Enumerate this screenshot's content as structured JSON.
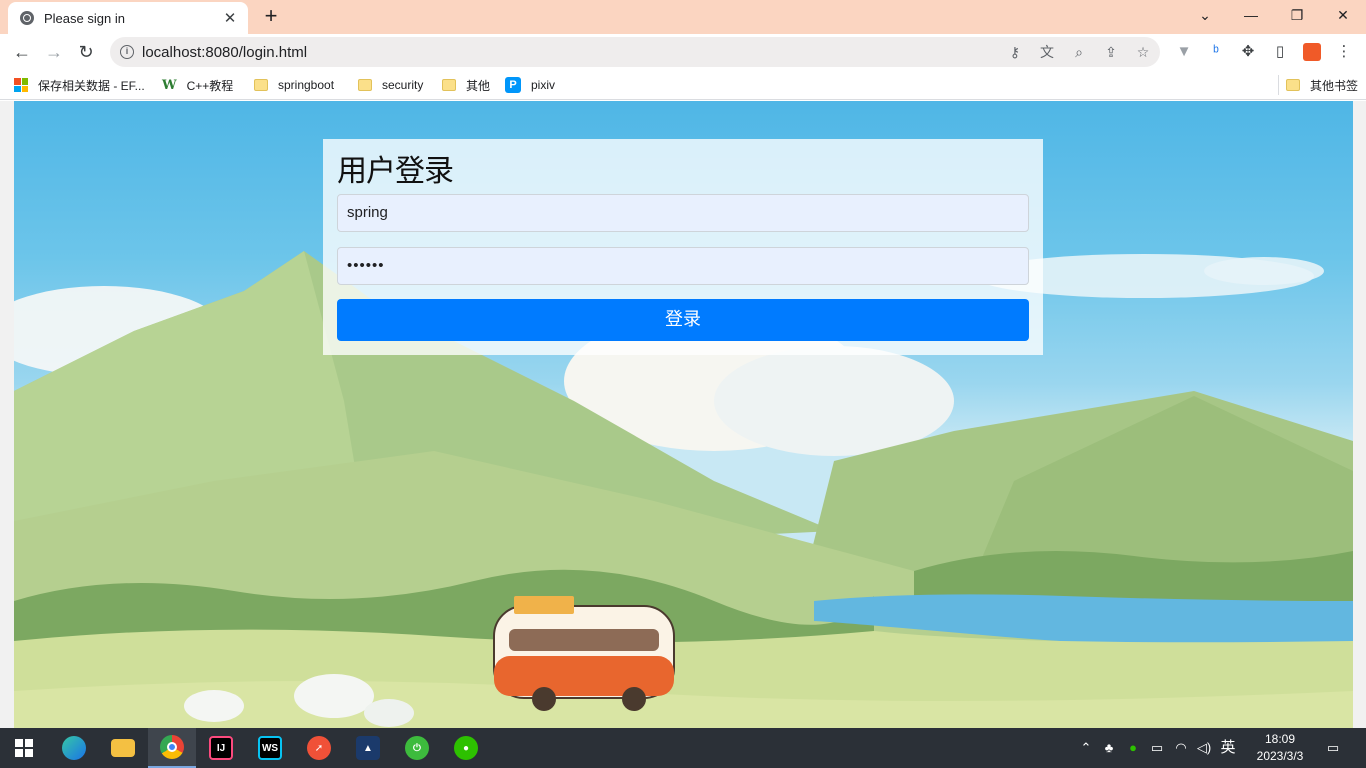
{
  "browser": {
    "tab_title": "Please sign in",
    "tab_close": "✕",
    "new_tab": "+",
    "window_controls": [
      "⌄",
      "—",
      "❐",
      "✕"
    ],
    "url": "localhost:8080/login.html",
    "back": "←",
    "forward": "→",
    "reload": "↻",
    "omnibox_icons": [
      "key-icon",
      "translate-icon",
      "zoom-icon",
      "share-icon",
      "star-icon"
    ],
    "extension_icons": [
      "vpn-icon",
      "bing-icon",
      "extensions-icon",
      "sidepanel-icon",
      "profile-icon",
      "menu-icon"
    ]
  },
  "bookmarks": {
    "items": [
      {
        "label": "保存相关数据 - EF...",
        "icon": "microsoft-icon"
      },
      {
        "label": "C++教程",
        "icon": "w3-icon"
      },
      {
        "label": "springboot",
        "icon": "folder-icon"
      },
      {
        "label": "security",
        "icon": "folder-icon"
      },
      {
        "label": "其他",
        "icon": "folder-icon"
      },
      {
        "label": "pixiv",
        "icon": "pixiv-icon"
      }
    ],
    "other": "其他书签"
  },
  "login": {
    "title": "用户登录",
    "username_value": "spring",
    "password_value": "••••••",
    "submit_label": "登录"
  },
  "colors": {
    "primary_button": "#007bff",
    "input_autofill_bg": "#e8f0fe",
    "titlebar_bg": "#fbd5c1",
    "taskbar_bg": "#2b3037"
  },
  "taskbar": {
    "apps": [
      "windows-start-icon",
      "edge-icon",
      "file-explorer-icon",
      "chrome-icon",
      "intellij-icon",
      "webstorm-icon",
      "swift-icon",
      "app-icon",
      "power-icon",
      "wechat-icon"
    ],
    "ime": "英",
    "time": "18:09",
    "date": "2023/3/3"
  }
}
